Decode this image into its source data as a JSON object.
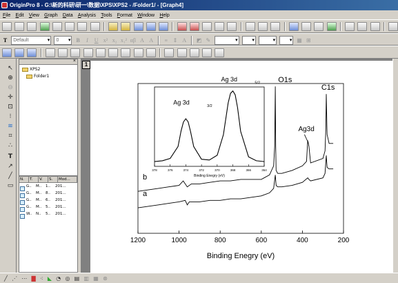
{
  "window": {
    "title": "OriginPro 8 - G:\\新的科研\\研一\\数据\\XPS\\XPS2 - /Folder1/ - [Graph4]"
  },
  "menu": [
    "File",
    "Edit",
    "View",
    "Graph",
    "Data",
    "Analysis",
    "Tools",
    "Format",
    "Window",
    "Help"
  ],
  "format_toolbar": {
    "font_name": "Default",
    "font_size": "0",
    "style_glyphs": [
      "B",
      "I",
      "U",
      "x²",
      "x₂",
      "x₁²",
      "αβ",
      "A",
      "A"
    ]
  },
  "explorer": {
    "close_label": "×",
    "root": "XPS2",
    "folder": "Folder1"
  },
  "file_list": {
    "columns": [
      "N.",
      "T.",
      "V.",
      "S.",
      "Mod..."
    ],
    "rows": [
      [
        "G..",
        "M..",
        "1..",
        "201..."
      ],
      [
        "G..",
        "M..",
        "8..",
        "201..."
      ],
      [
        "G..",
        "M..",
        "6..",
        "201..."
      ],
      [
        "G..",
        "M..",
        "5..",
        "201..."
      ],
      [
        "W..",
        "N..",
        "5..",
        "201..."
      ]
    ]
  },
  "layer": {
    "number": "1"
  },
  "chart_data": [
    {
      "type": "line",
      "name": "main",
      "xlabel": "Binding Enegry (eV)",
      "ylabel": "",
      "xlim": [
        1200,
        200
      ],
      "x_ticks": [
        1200,
        1000,
        800,
        600,
        400,
        200
      ],
      "series": [
        {
          "name": "b",
          "x": [
            1200,
            1150,
            1100,
            1050,
            1000,
            980,
            960,
            940,
            900,
            850,
            800,
            750,
            700,
            650,
            600,
            560,
            540,
            535,
            532,
            530,
            528,
            520,
            500,
            450,
            400,
            380,
            374,
            368,
            360,
            300,
            290,
            286,
            284,
            280,
            270,
            250
          ],
          "y": [
            0.28,
            0.29,
            0.3,
            0.31,
            0.32,
            0.35,
            0.31,
            0.33,
            0.33,
            0.34,
            0.35,
            0.35,
            0.36,
            0.36,
            0.36,
            0.39,
            0.45,
            0.58,
            0.98,
            0.58,
            0.42,
            0.4,
            0.4,
            0.42,
            0.45,
            0.48,
            0.62,
            0.58,
            0.47,
            0.5,
            0.55,
            0.7,
            0.93,
            0.66,
            0.6,
            0.6
          ]
        },
        {
          "name": "a",
          "x": [
            1200,
            1150,
            1100,
            1050,
            1000,
            970,
            960,
            950,
            900,
            850,
            800,
            750,
            700,
            650,
            600,
            560,
            540,
            532,
            528,
            520,
            500,
            450,
            400,
            374,
            368,
            360,
            300,
            290,
            284,
            280,
            270,
            250
          ],
          "y": [
            0.17,
            0.18,
            0.19,
            0.2,
            0.21,
            0.22,
            0.19,
            0.21,
            0.21,
            0.22,
            0.22,
            0.23,
            0.23,
            0.24,
            0.25,
            0.27,
            0.3,
            0.39,
            0.32,
            0.31,
            0.31,
            0.32,
            0.34,
            0.37,
            0.36,
            0.35,
            0.37,
            0.4,
            0.52,
            0.44,
            0.43,
            0.43
          ]
        }
      ],
      "annotations": {
        "o1s": "O1s",
        "c1s": "C1s",
        "ag3d": "Ag3d",
        "label_a": "a",
        "label_b": "b"
      }
    },
    {
      "type": "line",
      "name": "inset",
      "xlabel": "Binding Enegry (eV)",
      "ylabel": "",
      "xlim": [
        378,
        364
      ],
      "x_ticks": [
        378,
        376,
        374,
        372,
        370,
        368,
        366,
        364
      ],
      "series": [
        {
          "name": "",
          "x": [
            378,
            377,
            376,
            375,
            374.6,
            374.3,
            374.0,
            373.7,
            373.4,
            373,
            372,
            371,
            370,
            369.2,
            368.6,
            368.3,
            368.0,
            367.7,
            367.4,
            367,
            366,
            365,
            364
          ],
          "y": [
            0.06,
            0.07,
            0.1,
            0.25,
            0.45,
            0.56,
            0.6,
            0.56,
            0.44,
            0.25,
            0.09,
            0.08,
            0.14,
            0.4,
            0.8,
            0.92,
            0.95,
            0.9,
            0.74,
            0.44,
            0.12,
            0.07,
            0.06
          ]
        }
      ],
      "annotations": {
        "peak1_main": "Ag 3d",
        "peak1_sub": "3/2",
        "peak2_main": "Ag 3d",
        "peak2_sub": "5/2"
      }
    }
  ]
}
